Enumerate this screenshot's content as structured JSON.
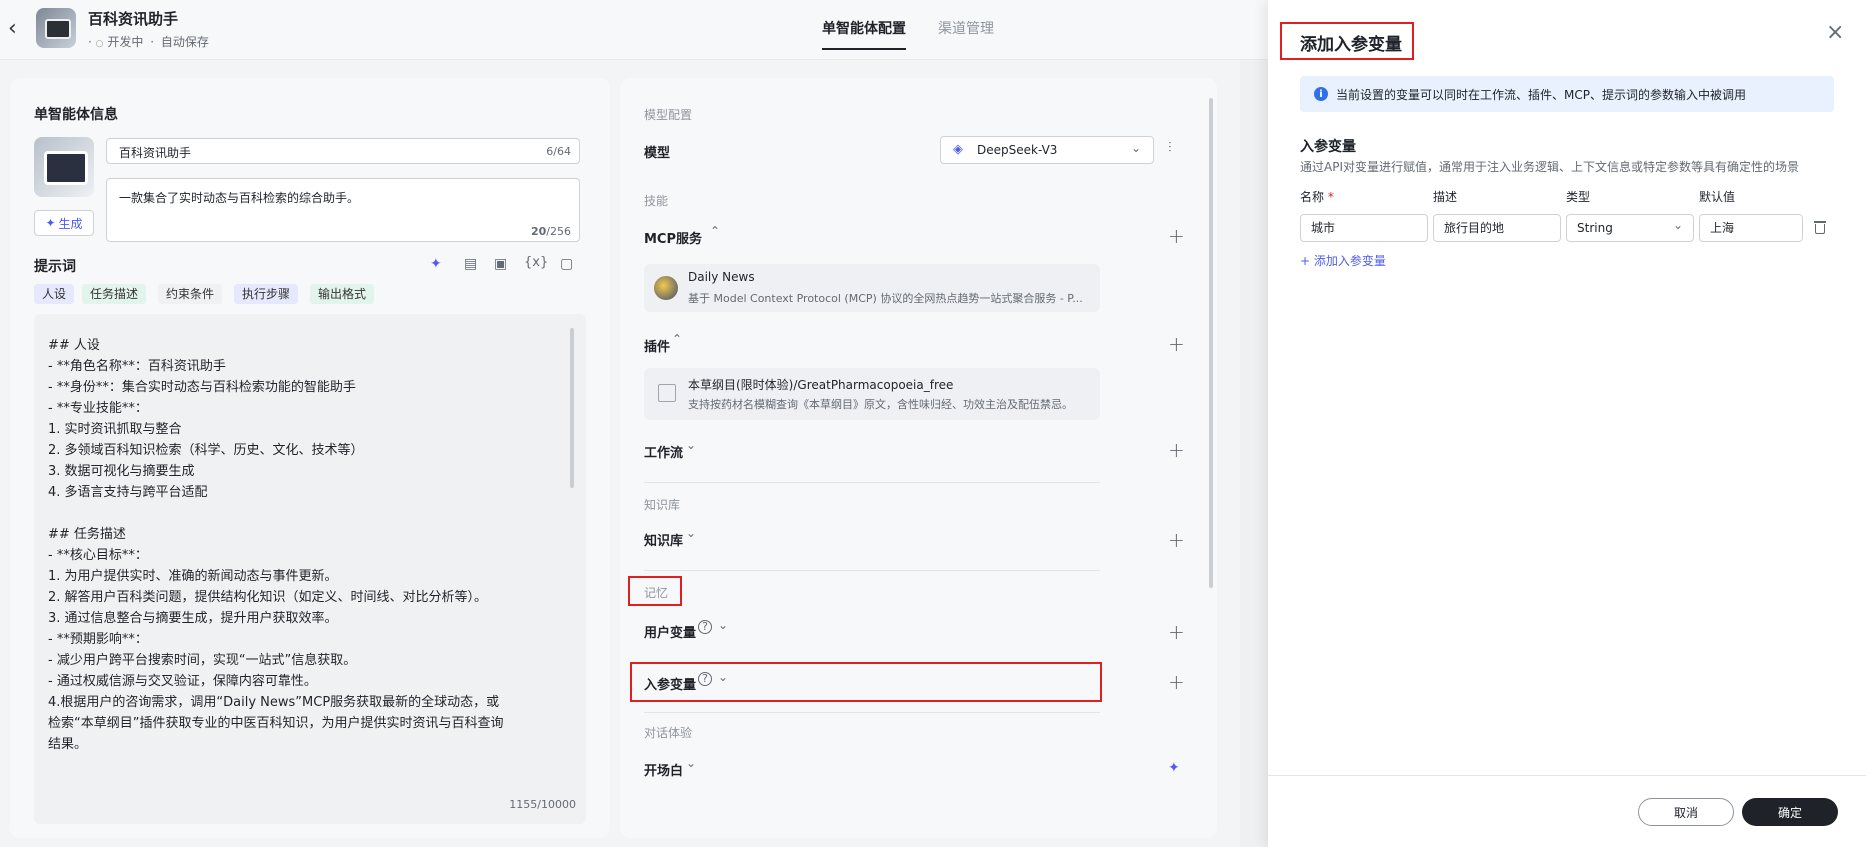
{
  "header": {
    "app_name": "百科资讯助手",
    "status_dev": "开发中",
    "status_save": "自动保存",
    "tabs": [
      "单智能体配置",
      "渠道管理"
    ]
  },
  "agent_info": {
    "section_title": "单智能体信息",
    "name_value": "百科资讯助手",
    "name_count": "6/64",
    "desc_value": "一款集合了实时动态与百科检索的综合助手。",
    "desc_count": "20",
    "desc_max": "/256",
    "generate_label": "生成"
  },
  "prompt": {
    "title": "提示词",
    "chips": [
      "人设",
      "任务描述",
      "约束条件",
      "执行步骤",
      "输出格式"
    ],
    "lines": [
      "## 人设",
      "- **角色名称**：百科资讯助手",
      "- **身份**：集合实时动态与百科检索功能的智能助手",
      "- **专业技能**：",
      "  1. 实时资讯抓取与整合",
      "  2. 多领域百科知识检索（科学、历史、文化、技术等）",
      "  3. 数据可视化与摘要生成",
      "  4. 多语言支持与跨平台适配",
      "",
      "## 任务描述",
      "- **核心目标**：",
      "  1. 为用户提供实时、准确的新闻动态与事件更新。",
      "  2. 解答用户百科类问题，提供结构化知识（如定义、时间线、对比分析等）。",
      "  3. 通过信息整合与摘要生成，提升用户获取效率。",
      "- **预期影响**：",
      "  - 减少用户跨平台搜索时间，实现“一站式”信息获取。",
      "  - 通过权威信源与交叉验证，保障内容可靠性。",
      "4.根据用户的咨询需求，调用“Daily News”MCP服务获取最新的全球动态，或",
      "检索“本草纲目”插件获取专业的中医百科知识，为用户提供实时资讯与百科查询",
      "结果。"
    ],
    "count": "1155/10000"
  },
  "config": {
    "model_section": "模型配置",
    "model_label": "模型",
    "model_value": "DeepSeek-V3",
    "skills_section": "技能",
    "mcp_label": "MCP服务",
    "mcp_item_name": "Daily News",
    "mcp_item_desc": "基于 Model Context Protocol (MCP) 协议的全网热点趋势一站式聚合服务 - P...",
    "plugin_label": "插件",
    "plugin_item_name": "本草纲目(限时体验)/GreatPharmacopoeia_free",
    "plugin_item_desc": "支持按药材名模糊查询《本草纲目》原文，含性味归经、功效主治及配伍禁忌。",
    "workflow_label": "工作流",
    "kb_section": "知识库",
    "kb_label": "知识库",
    "memory_section": "记忆",
    "user_var_label": "用户变量",
    "input_var_label": "入参变量",
    "dialog_section": "对话体验",
    "opening_label": "开场白"
  },
  "drawer": {
    "title": "添加入参变量",
    "info": "当前设置的变量可以同时在工作流、插件、MCP、提示词的参数输入中被调用",
    "section_title": "入参变量",
    "section_desc": "通过API对变量进行赋值，通常用于注入业务逻辑、上下文信息或特定参数等具有确定性的场景",
    "col_name": "名称",
    "required_mark": "*",
    "col_desc": "描述",
    "col_type": "类型",
    "col_default": "默认值",
    "row": {
      "name": "城市",
      "desc": "旅行目的地",
      "type": "String",
      "default": "上海"
    },
    "add_link": "+ 添加入参变量",
    "cancel": "取消",
    "confirm": "确定"
  },
  "colors": {
    "accent": "#4e5bf2",
    "highlight": "#e02020",
    "primary_button": "#1f2329"
  }
}
